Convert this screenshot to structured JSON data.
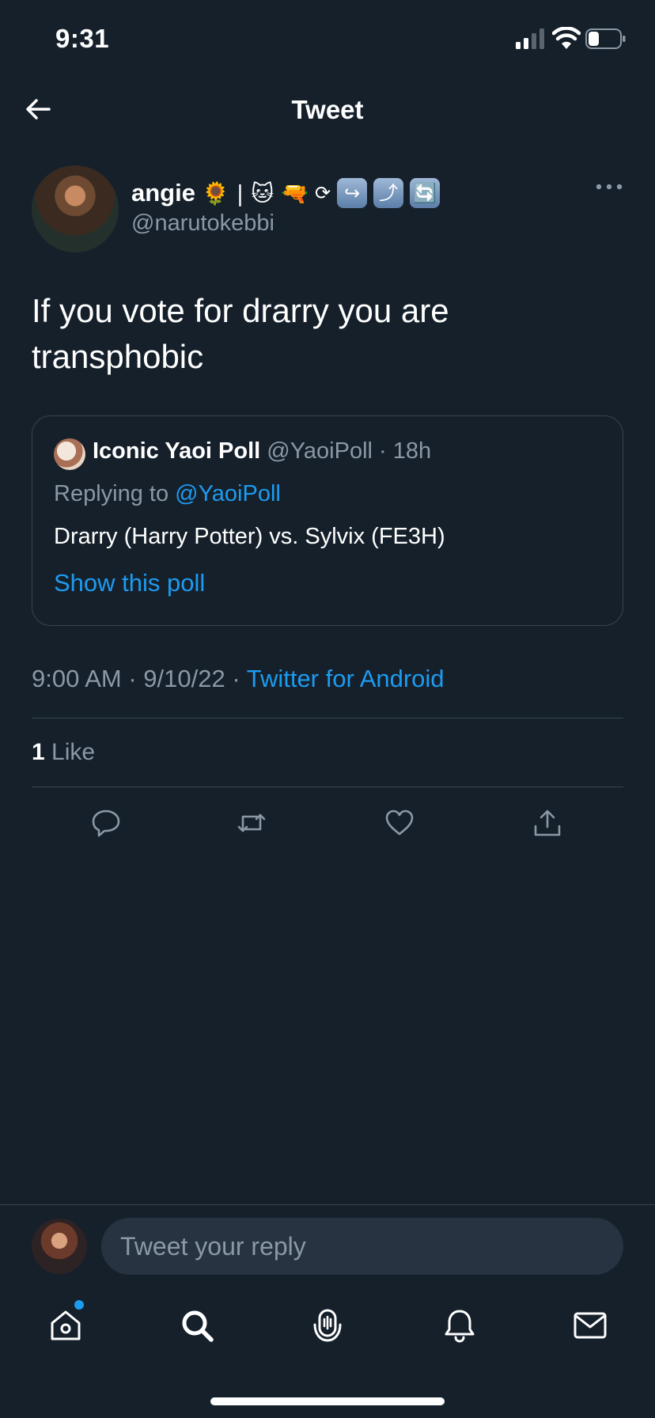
{
  "status_bar": {
    "time": "9:31"
  },
  "nav": {
    "title": "Tweet"
  },
  "author": {
    "name": "angie",
    "name_emojis": "🌻 | 🐱 🔫",
    "badge_glyphs": [
      "⟳",
      "↪",
      "⤴",
      "🔄"
    ],
    "handle": "@narutokebbi"
  },
  "tweet": {
    "text": "If you vote for drarry you are transphobic",
    "timestamp": "9:00 AM · 9/10/22 · ",
    "source": "Twitter for Android"
  },
  "quote": {
    "name": "Iconic Yaoi Poll",
    "meta": " @YaoiPoll · 18h",
    "replying_prefix": "Replying to ",
    "replying_handle": "@YaoiPoll",
    "text": "Drarry (Harry Potter) vs. Sylvix (FE3H)",
    "show_poll": "Show this poll"
  },
  "likes": {
    "count": "1",
    "label": " Like"
  },
  "composer": {
    "placeholder": "Tweet your reply"
  },
  "colors": {
    "background": "#15202b",
    "accent": "#1d9bf0",
    "muted": "#8b98a5",
    "divider": "#38444d"
  },
  "icons": {
    "actions": [
      "reply-icon",
      "retweet-icon",
      "like-icon",
      "share-icon"
    ],
    "tabs": [
      "home-icon",
      "search-icon",
      "spaces-icon",
      "notifications-icon",
      "messages-icon"
    ]
  }
}
